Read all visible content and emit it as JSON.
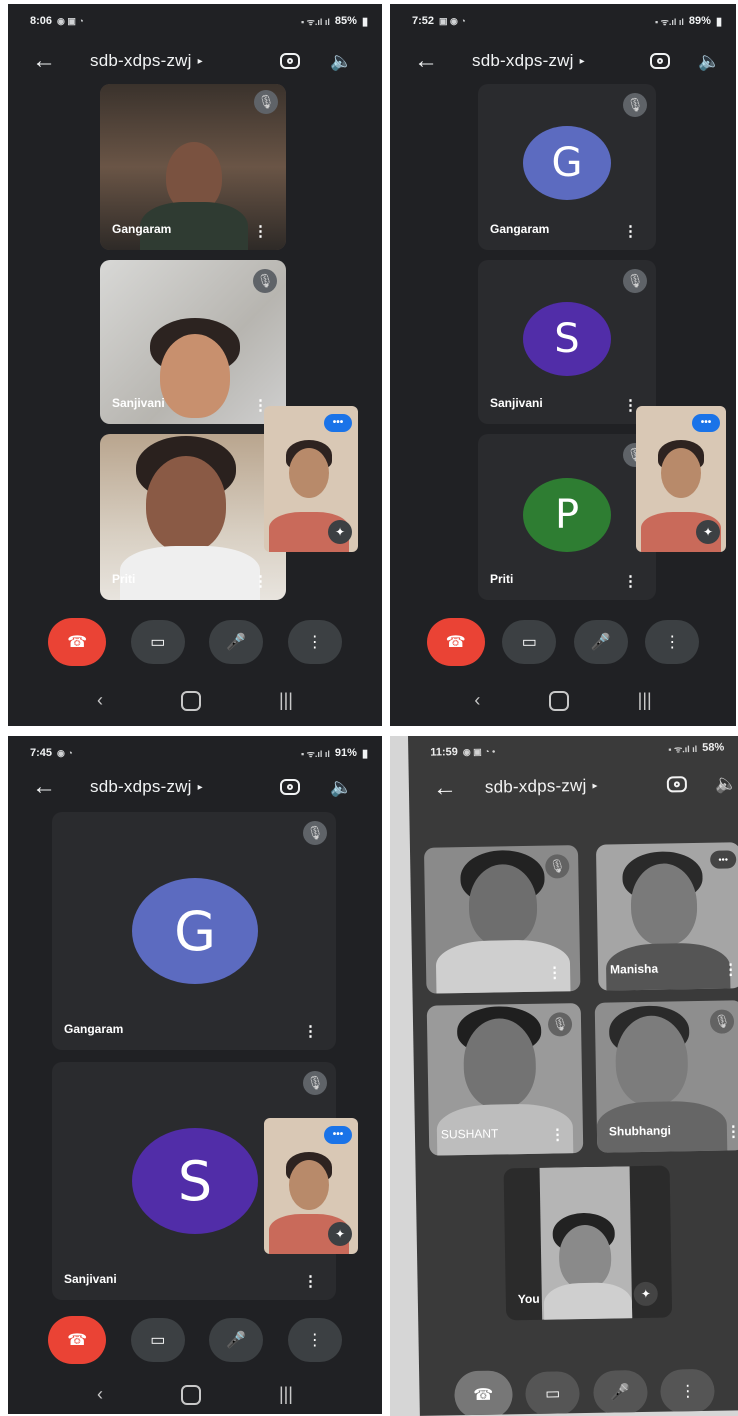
{
  "meeting_code": "sdb-xdps-zwj",
  "icons": {
    "back": "←",
    "caret": "▸",
    "speaker": "🔈",
    "mute": "🎙",
    "menu": "⋮",
    "end_call": "☎",
    "camera": "▭",
    "mic": "🎤",
    "more": "⋮",
    "nav_back": "‹",
    "nav_recent": "|||",
    "pip_more": "•••",
    "effects": "✦"
  },
  "colors": {
    "panel_bg": "#202124",
    "tile_bg": "#3c4043",
    "end_call": "#ea4335",
    "accent_blue": "#1a73e8",
    "avatar_g": "#5c6bc0",
    "avatar_s": "#512da8",
    "avatar_p": "#2e7d32"
  },
  "screens": [
    {
      "status": {
        "time": "8:06",
        "battery": "85%"
      },
      "tiles": [
        {
          "name": "Gangaram"
        },
        {
          "name": "Sanjivani"
        },
        {
          "name": "Priti"
        }
      ]
    },
    {
      "status": {
        "time": "7:52",
        "battery": "89%"
      },
      "tiles": [
        {
          "name": "Gangaram",
          "initial": "G"
        },
        {
          "name": "Sanjivani",
          "initial": "S"
        },
        {
          "name": "Priti",
          "initial": "P"
        }
      ]
    },
    {
      "status": {
        "time": "7:45",
        "battery": "91%"
      },
      "tiles": [
        {
          "name": "Gangaram",
          "initial": "G"
        },
        {
          "name": "Sanjivani",
          "initial": "S"
        }
      ]
    },
    {
      "status": {
        "time": "11:59",
        "battery": "58%"
      },
      "tiles": [
        {
          "name": ""
        },
        {
          "name": "Manisha"
        },
        {
          "name": "SUSHANT"
        },
        {
          "name": "Shubhangi"
        },
        {
          "name": "You"
        }
      ]
    }
  ]
}
